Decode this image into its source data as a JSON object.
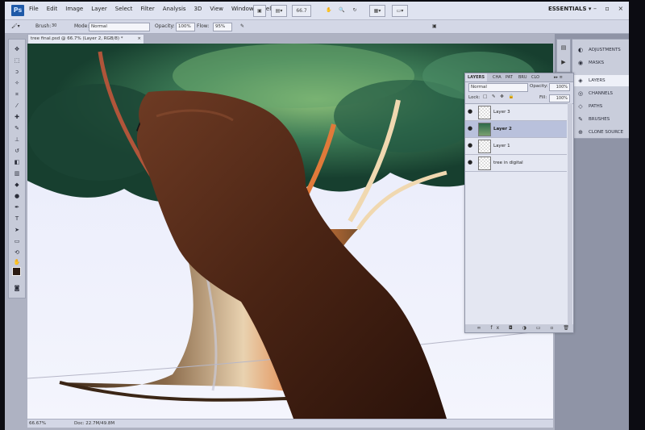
{
  "app": {
    "logo": "Ps",
    "workspace": "ESSENTIALS",
    "window_buttons": "– ▫ ×"
  },
  "menu": [
    "File",
    "Edit",
    "Image",
    "Layer",
    "Select",
    "Filter",
    "Analysis",
    "3D",
    "View",
    "Window",
    "Help"
  ],
  "toolbar_top": {
    "zoom": "66.7"
  },
  "options": {
    "brush_label": "Brush:",
    "brush_size": "30",
    "mode_label": "Mode:",
    "mode_value": "Normal",
    "opacity_label": "Opacity:",
    "opacity_value": "100%",
    "flow_label": "Flow:",
    "flow_value": "95%"
  },
  "document": {
    "tab_title": "tree final.psd @ 66.7% (Layer 2, RGB/8) *",
    "close": "×"
  },
  "status": {
    "zoom": "66.67%",
    "doc": "Doc: 22.7M/49.8M"
  },
  "panels_dock": [
    {
      "label": "ADJUSTMENTS",
      "icon": "adjustments-icon"
    },
    {
      "label": "MASKS",
      "icon": "masks-icon"
    },
    {
      "label": "LAYERS",
      "icon": "layers-icon",
      "selected": true
    },
    {
      "label": "CHANNELS",
      "icon": "channels-icon"
    },
    {
      "label": "PATHS",
      "icon": "paths-icon"
    },
    {
      "label": "BRUSHES",
      "icon": "brushes-icon"
    },
    {
      "label": "CLONE SOURCE",
      "icon": "clone-source-icon"
    }
  ],
  "layers_panel": {
    "tabs": [
      "LAYERS",
      "CHA",
      "PAT",
      "BRU",
      "CLO"
    ],
    "blend_mode": "Normal",
    "opacity_label": "Opacity:",
    "opacity": "100%",
    "lock_label": "Lock:",
    "fill_label": "Fill:",
    "fill": "100%",
    "layers": [
      {
        "name": "Layer 3",
        "selected": false
      },
      {
        "name": "Layer 2",
        "selected": true
      },
      {
        "name": "Layer 1",
        "selected": false
      },
      {
        "name": "tree in digital",
        "selected": false
      }
    ],
    "footer_icons": "∞ fx ◘ ◑ ▭ ▫ 🗑"
  },
  "colors": {
    "accent": "#1f5aa8",
    "canvas_bg": "#eef0fb",
    "foliage": "#1f4a36",
    "trunk": "#5a3b22"
  }
}
